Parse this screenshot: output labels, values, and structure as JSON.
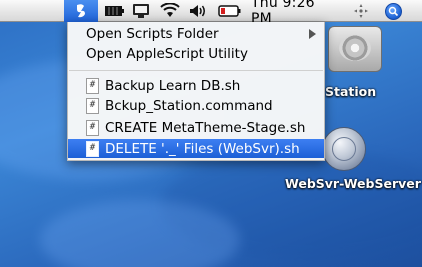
{
  "menubar": {
    "icons": [
      "script-menu-icon",
      "battery-indicator-icon",
      "display-icon",
      "wifi-icon",
      "volume-icon",
      "battery-icon",
      "hand-icon",
      "spotlight-icon"
    ],
    "clock": "Thu 9:26 PM"
  },
  "menu": {
    "items": [
      {
        "label": "Open Scripts Folder",
        "has_submenu": true
      },
      {
        "label": "Open AppleScript Utility"
      },
      {
        "label": "Backup Learn DB.sh",
        "icon": "#"
      },
      {
        "label": "Bckup_Station.command",
        "icon": "#"
      },
      {
        "label": "CREATE MetaTheme-Stage.sh",
        "icon": "#"
      },
      {
        "label": "DELETE '._' Files (WebSvr).sh",
        "icon": "#",
        "selected": true
      }
    ]
  },
  "desktop": {
    "volume1_label": "Station",
    "volume2_label": "WebSvr-WebServer"
  },
  "colors": {
    "selection": "#1c5fd6",
    "desktop": "#2d6fc4"
  }
}
